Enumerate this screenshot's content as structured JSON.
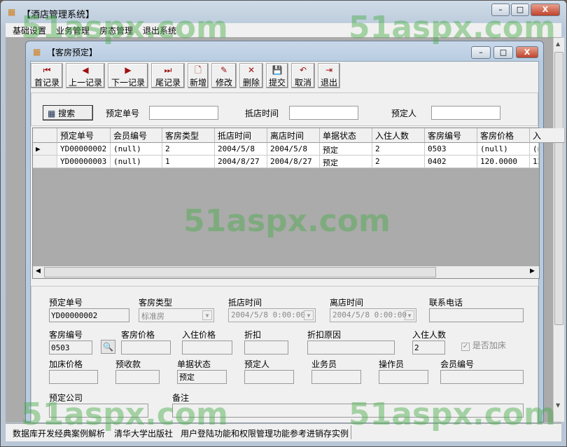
{
  "app": {
    "title": "【酒店管理系统】"
  },
  "menu": [
    "基础设置",
    "业务管理",
    "房态管理",
    "退出系统"
  ],
  "child": {
    "title": "【客房预定】"
  },
  "toolbar": [
    {
      "label": "首记录",
      "icon": "first-icon",
      "glyph": "⏮"
    },
    {
      "label": "上一记录",
      "icon": "prev-icon",
      "glyph": "◀"
    },
    {
      "label": "下一记录",
      "icon": "next-icon",
      "glyph": "▶"
    },
    {
      "label": "尾记录",
      "icon": "last-icon",
      "glyph": "⏭"
    },
    {
      "label": "新增",
      "icon": "new-doc-icon",
      "glyph": "🗋"
    },
    {
      "label": "修改",
      "icon": "edit-icon",
      "glyph": "✎"
    },
    {
      "label": "删除",
      "icon": "delete-icon",
      "glyph": "✕"
    },
    {
      "label": "提交",
      "icon": "save-icon",
      "glyph": "💾"
    },
    {
      "label": "取消",
      "icon": "undo-icon",
      "glyph": "↶"
    },
    {
      "label": "退出",
      "icon": "exit-icon",
      "glyph": "⇥"
    }
  ],
  "search": {
    "button": "搜索",
    "labels": [
      "预定单号",
      "抵店时间",
      "预定人"
    ],
    "values": [
      "",
      "",
      ""
    ]
  },
  "grid": {
    "columns": [
      "预定单号",
      "会员编号",
      "客房类型",
      "抵店时间",
      "离店时间",
      "单据状态",
      "入住人数",
      "客房编号",
      "客房价格",
      "入"
    ],
    "rows": [
      [
        "YD00000002",
        "(null)",
        "2",
        "2004/5/8",
        "2004/5/8",
        "预定",
        "2",
        "0503",
        "(null)",
        "(n"
      ],
      [
        "YD00000003",
        "(null)",
        "1",
        "2004/8/27",
        "2004/8/27",
        "预定",
        "2",
        "0402",
        "120.0000",
        "12"
      ]
    ]
  },
  "detail": {
    "fields": [
      {
        "label": "预定单号",
        "value": "YD00000002"
      },
      {
        "label": "客房类型",
        "value": "标准房",
        "combo": true
      },
      {
        "label": "抵店时间",
        "value": "2004/5/8 0:00:00",
        "combo": true
      },
      {
        "label": "离店时间",
        "value": "2004/5/8 0:00:00",
        "combo": true
      },
      {
        "label": "联系电话",
        "value": ""
      },
      {
        "label": "客房编号",
        "value": "0503"
      },
      {
        "label": "客房价格",
        "value": ""
      },
      {
        "label": "入住价格",
        "value": ""
      },
      {
        "label": "折扣",
        "value": ""
      },
      {
        "label": "折扣原因",
        "value": ""
      },
      {
        "label": "入住人数",
        "value": "2"
      },
      {
        "label": "加床价格",
        "value": ""
      },
      {
        "label": "预收款",
        "value": ""
      },
      {
        "label": "单据状态",
        "value": "预定"
      },
      {
        "label": "预定人",
        "value": ""
      },
      {
        "label": "业务员",
        "value": ""
      },
      {
        "label": "操作员",
        "value": ""
      },
      {
        "label": "会员编号",
        "value": ""
      },
      {
        "label": "预定公司",
        "value": ""
      },
      {
        "label": "备注",
        "value": ""
      }
    ],
    "extra_bed": {
      "label": "是否加床",
      "checked": true
    }
  },
  "status": [
    "数据库开发经典案例解析",
    "清华大学出版社",
    "用户登陆功能和权限管理功能参考进销存实例"
  ],
  "watermark": "51aspx.com"
}
